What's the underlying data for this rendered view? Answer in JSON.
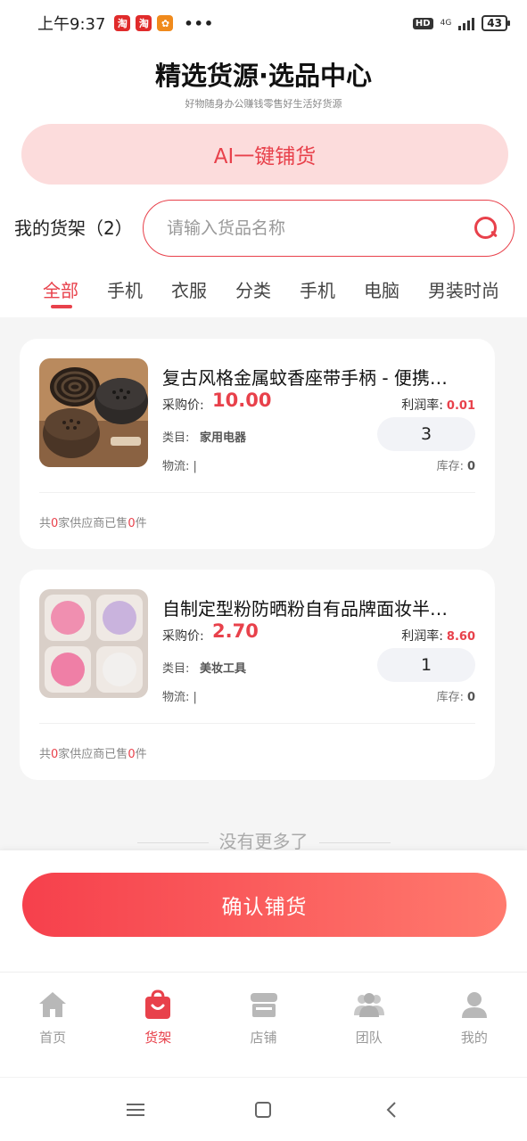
{
  "status_bar": {
    "time": "上午9:37",
    "app_icons": [
      "taobao-icon",
      "taobao-icon",
      "app-icon"
    ],
    "hd": "HD",
    "network": "4G",
    "battery": "43"
  },
  "header": {
    "title": "精选货源·选品中心",
    "subtitle": "好物随身办公赚钱零售好生活好货源"
  },
  "ai_button": {
    "label": "AI一键铺货"
  },
  "shelf": {
    "label": "我的货架（2）"
  },
  "search": {
    "placeholder": "请输入货品名称",
    "value": ""
  },
  "tabs": [
    {
      "label": "全部",
      "active": true
    },
    {
      "label": "手机",
      "active": false
    },
    {
      "label": "衣服",
      "active": false
    },
    {
      "label": "分类",
      "active": false
    },
    {
      "label": "手机",
      "active": false
    },
    {
      "label": "电脑",
      "active": false
    },
    {
      "label": "男装时尚",
      "active": false
    }
  ],
  "products": [
    {
      "name": "复古风格金属蚊香座带手柄 - 便携…",
      "price_label": "采购价:",
      "price": "10.00",
      "profit_label": "利润率:",
      "profit": "0.01",
      "category_label": "类目:",
      "category": "家用电器",
      "quantity": "3",
      "logistics_label": "物流:",
      "logistics": "|",
      "stock_label": "库存:",
      "stock": "0",
      "supplier_prefix": "共",
      "supplier_count": "0",
      "supplier_mid": "家供应商已售",
      "sold_count": "0",
      "supplier_suffix": "件"
    },
    {
      "name": "自制定型粉防晒粉自有品牌面妆半…",
      "price_label": "采购价:",
      "price": "2.70",
      "profit_label": "利润率:",
      "profit": "8.60",
      "category_label": "类目:",
      "category": "美妆工具",
      "quantity": "1",
      "logistics_label": "物流:",
      "logistics": "|",
      "stock_label": "库存:",
      "stock": "0",
      "supplier_prefix": "共",
      "supplier_count": "0",
      "supplier_mid": "家供应商已售",
      "sold_count": "0",
      "supplier_suffix": "件"
    }
  ],
  "no_more": "没有更多了",
  "confirm_button": {
    "label": "确认铺货"
  },
  "tabbar": [
    {
      "label": "首页",
      "icon": "home-icon",
      "active": false
    },
    {
      "label": "货架",
      "icon": "shopping-bag-icon",
      "active": true
    },
    {
      "label": "店铺",
      "icon": "store-icon",
      "active": false
    },
    {
      "label": "团队",
      "icon": "team-icon",
      "active": false
    },
    {
      "label": "我的",
      "icon": "user-icon",
      "active": false
    }
  ],
  "colors": {
    "accent": "#e8414b",
    "ai_button_bg": "#fcdcdc",
    "list_bg": "#f5f5f5"
  }
}
